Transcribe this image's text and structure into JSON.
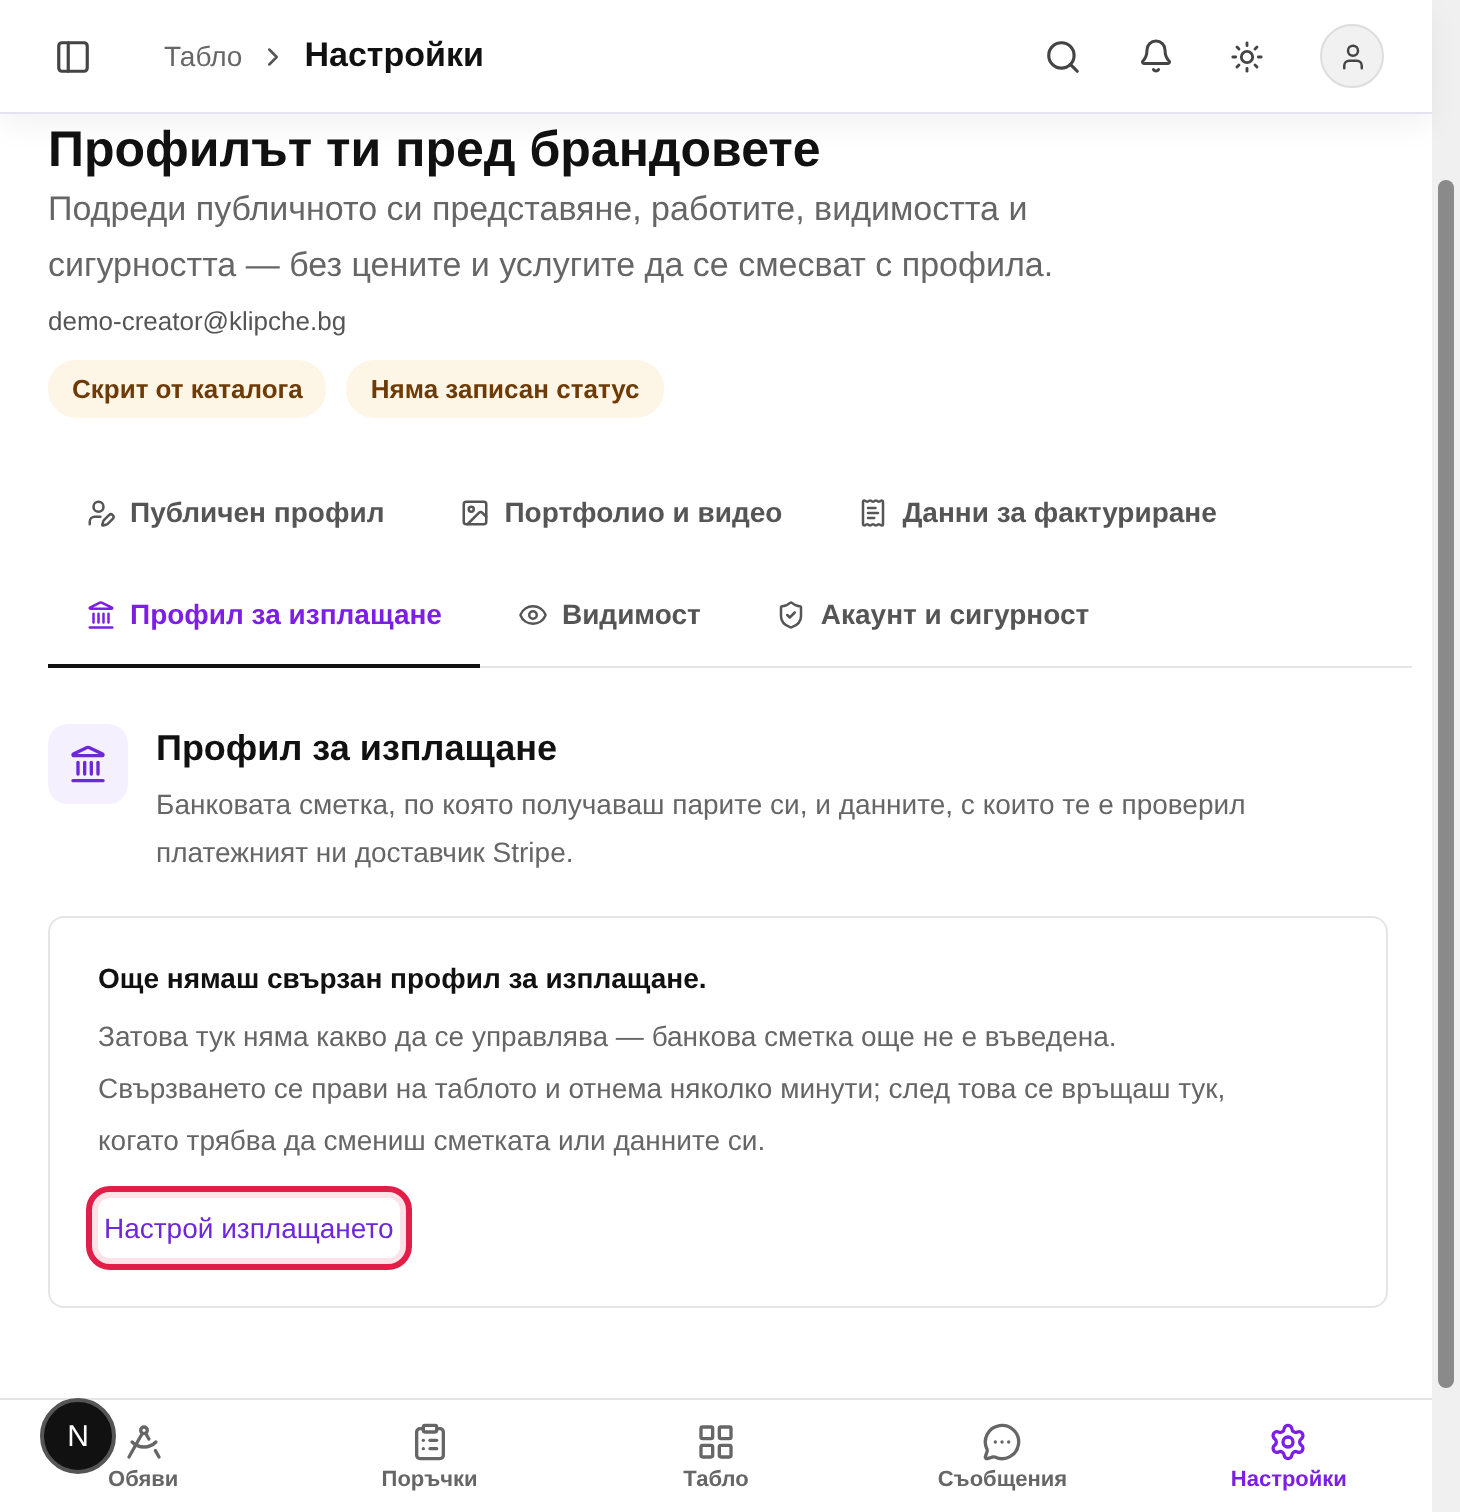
{
  "header": {
    "breadcrumb": [
      {
        "label": "Табло",
        "current": false
      },
      {
        "label": "Настройки",
        "current": true
      }
    ]
  },
  "page": {
    "title": "Профилът ти пред брандовете",
    "subtitle": "Подреди публичното си представяне, работите, видимостта и сигурността — без цените и услугите да се смесват с профила.",
    "email": "demo-creator@klipche.bg",
    "badges": [
      "Скрит от каталога",
      "Няма записан статус"
    ]
  },
  "tabs": [
    {
      "label": "Публичен профил",
      "selected": false
    },
    {
      "label": "Портфолио и видео",
      "selected": false
    },
    {
      "label": "Данни за фактуриране",
      "selected": false
    },
    {
      "label": "Профил за изплащане",
      "selected": true
    },
    {
      "label": "Видимост",
      "selected": false
    },
    {
      "label": "Акаунт и сигурност",
      "selected": false
    }
  ],
  "section": {
    "title": "Профил за изплащане",
    "description": "Банковата сметка, по която получаваш парите си, и данните, с които те е проверил платежният ни доставчик Stripe.",
    "card": {
      "title": "Още нямаш свързан профил за изплащане.",
      "text": "Затова тук няма какво да се управлява — банкова сметка още не е въведена. Свързването се прави на таблото и отнема няколко минути; след това се връщаш тук, когато трябва да смениш сметката или данните си.",
      "action": "Настрой изплащането"
    }
  },
  "bottom_nav": [
    {
      "label": "Обяви",
      "selected": false
    },
    {
      "label": "Поръчки",
      "selected": false
    },
    {
      "label": "Табло",
      "selected": false
    },
    {
      "label": "Съобщения",
      "selected": false
    },
    {
      "label": "Настройки",
      "selected": true
    }
  ],
  "dev_badge": "N"
}
